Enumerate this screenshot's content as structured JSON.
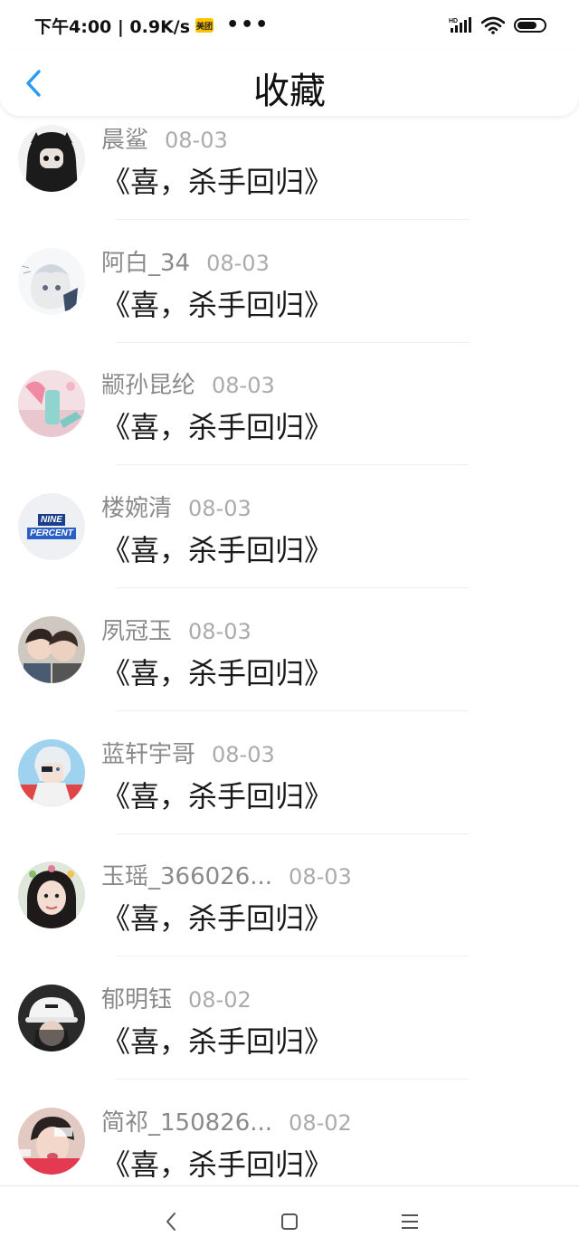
{
  "status_bar": {
    "time_speed": "下午4:00 | 0.9K/s",
    "app_badge": "美团",
    "more": "•••",
    "network": "HD",
    "battery_level": 0.75
  },
  "header": {
    "title": "收藏",
    "back_icon": "chevron-left-icon"
  },
  "items": [
    {
      "user": "晨鲨",
      "date": "08-03",
      "title": "《喜，杀手回归》"
    },
    {
      "user": "阿白_34",
      "date": "08-03",
      "title": "《喜，杀手回归》"
    },
    {
      "user": "颛孙昆纶",
      "date": "08-03",
      "title": "《喜，杀手回归》"
    },
    {
      "user": "楼婉清",
      "date": "08-03",
      "title": "《喜，杀手回归》",
      "avatar_text": [
        "NINE",
        "PERCENT"
      ]
    },
    {
      "user": "夙冠玉",
      "date": "08-03",
      "title": "《喜，杀手回归》"
    },
    {
      "user": "蓝轩宇哥",
      "date": "08-03",
      "title": "《喜，杀手回归》"
    },
    {
      "user": "玉瑶_366026...",
      "date": "08-03",
      "title": "《喜，杀手回归》"
    },
    {
      "user": "郁明钰",
      "date": "08-02",
      "title": "《喜，杀手回归》"
    },
    {
      "user": "简祁_150826...",
      "date": "08-02",
      "title": "《喜，杀手回归》"
    }
  ],
  "nav_bar": {
    "back_icon": "nav-back-icon",
    "home_icon": "nav-home-icon",
    "menu_icon": "nav-menu-icon"
  },
  "colors": {
    "accent": "#2a9af0",
    "username": "#8a8a8a",
    "date": "#ababab"
  }
}
